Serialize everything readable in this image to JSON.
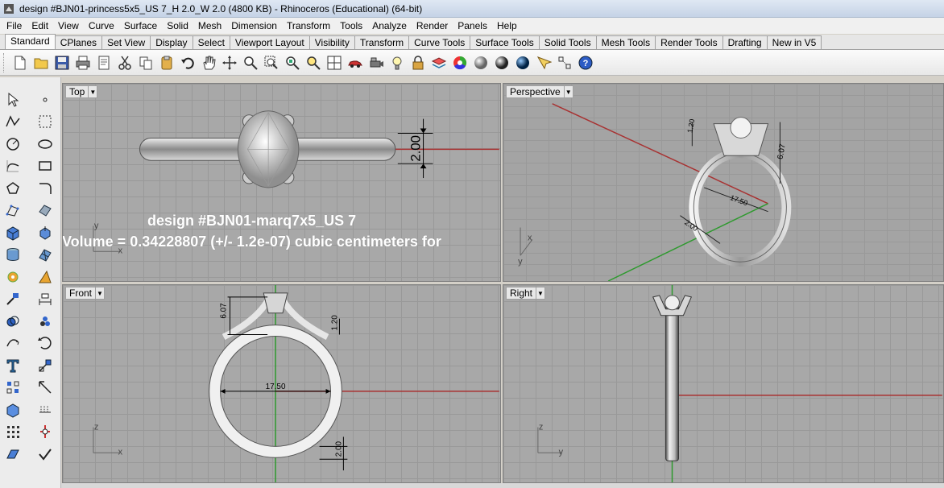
{
  "window": {
    "title": "design #BJN01-princess5x5_US 7_H 2.0_W 2.0 (4800 KB) - Rhinoceros (Educational) (64-bit)"
  },
  "menu": [
    "File",
    "Edit",
    "View",
    "Curve",
    "Surface",
    "Solid",
    "Mesh",
    "Dimension",
    "Transform",
    "Tools",
    "Analyze",
    "Render",
    "Panels",
    "Help"
  ],
  "tabs": [
    "Standard",
    "CPlanes",
    "Set View",
    "Display",
    "Select",
    "Viewport Layout",
    "Visibility",
    "Transform",
    "Curve Tools",
    "Surface Tools",
    "Solid Tools",
    "Mesh Tools",
    "Render Tools",
    "Drafting",
    "New in V5"
  ],
  "active_tab": "Standard",
  "toolbar_icons": [
    "new-file-icon",
    "open-folder-icon",
    "save-icon",
    "print-icon",
    "document-icon",
    "cut-icon",
    "copy-icon",
    "paste-icon",
    "undo-icon",
    "pan-hand-icon",
    "rotate-view-icon",
    "zoom-icon",
    "zoom-window-icon",
    "zoom-extents-icon",
    "zoom-selected-icon",
    "four-view-icon",
    "car-icon",
    "camera-icon",
    "light-bulb-icon",
    "lock-icon",
    "layer-icon",
    "color-wheel-icon",
    "sphere-shaded-icon",
    "sphere-rendered-icon",
    "sphere-blue-icon",
    "osnap-icon",
    "grid-snap-icon",
    "help-icon"
  ],
  "viewports": {
    "top": {
      "label": "Top",
      "axis_x": "x",
      "axis_y": "y",
      "dimension": "2.00"
    },
    "perspective": {
      "label": "Perspective",
      "axis_x": "x",
      "axis_y": "y",
      "dim_height": "6.07",
      "dim_diameter": "17.50",
      "dim_small": "1.20",
      "dim_band": "2.00"
    },
    "front": {
      "label": "Front",
      "axis_x": "x",
      "axis_z": "z",
      "dim_height": "6.07",
      "dim_small": "1.20",
      "dim_diameter": "17.50",
      "dim_band": "2.00"
    },
    "right": {
      "label": "Right",
      "axis_y": "y",
      "axis_z": "z"
    }
  },
  "overlay": {
    "line1": "design #BJN01-marq7x5_US 7",
    "line2": "Volume = 0.34228807 (+/- 1.2e-07) cubic centimeters for"
  },
  "colors": {
    "viewport_bg": "#a8a8a8",
    "grid_line": "#999999",
    "x_axis": "#a83232",
    "y_axis": "#2e9a2e"
  }
}
